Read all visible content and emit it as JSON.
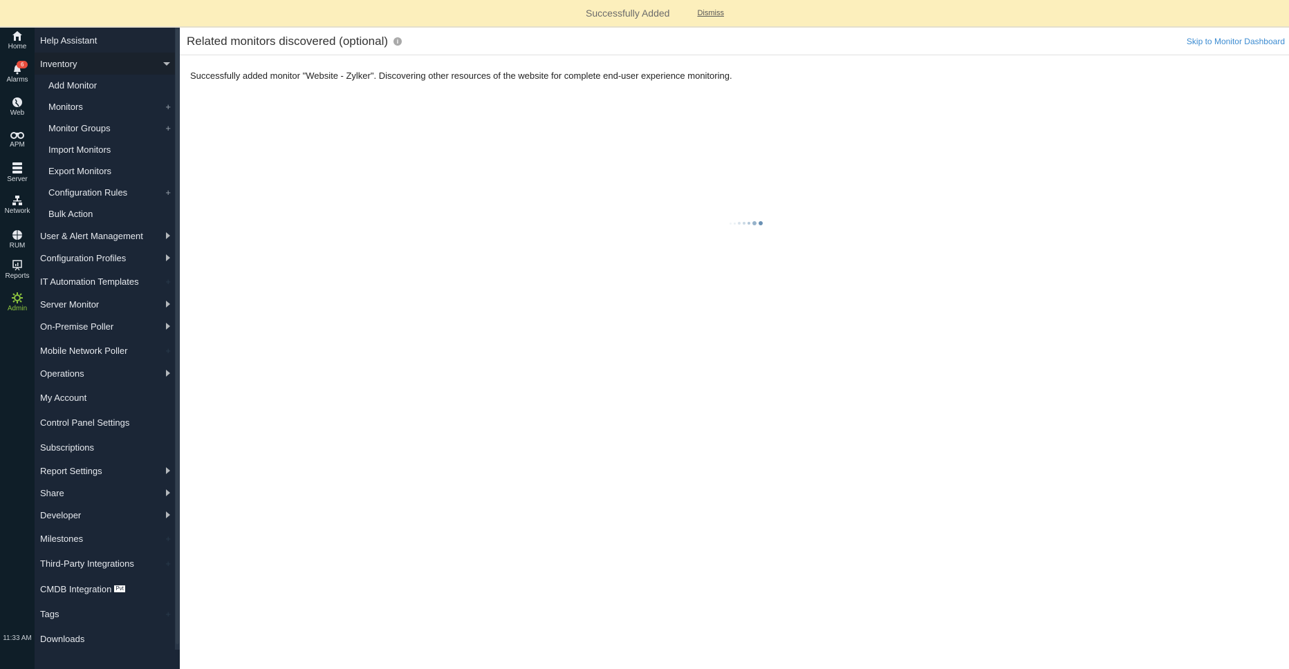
{
  "banner": {
    "message": "Successfully Added",
    "dismiss": "Dismiss"
  },
  "rail": {
    "items": [
      {
        "label": "Home",
        "icon": "home-icon"
      },
      {
        "label": "Alarms",
        "icon": "bell-icon",
        "badge": "6"
      },
      {
        "label": "Web",
        "icon": "globe-icon"
      },
      {
        "label": "APM",
        "icon": "binoculars-icon"
      },
      {
        "label": "Server",
        "icon": "server-icon"
      },
      {
        "label": "Network",
        "icon": "network-icon"
      },
      {
        "label": "RUM",
        "icon": "rum-globe-icon"
      },
      {
        "label": "Reports",
        "icon": "reports-icon"
      },
      {
        "label": "Admin",
        "icon": "gear-icon",
        "active": true
      }
    ],
    "time": "11:33 AM"
  },
  "menu": {
    "items": [
      {
        "label": "Help Assistant"
      },
      {
        "label": "Inventory",
        "indicator": "expanded"
      },
      {
        "label": "Add Monitor",
        "sub": true
      },
      {
        "label": "Monitors",
        "sub": true,
        "indicator": "plus"
      },
      {
        "label": "Monitor Groups",
        "sub": true,
        "indicator": "plus"
      },
      {
        "label": "Import Monitors",
        "sub": true
      },
      {
        "label": "Export Monitors",
        "sub": true
      },
      {
        "label": "Configuration Rules",
        "sub": true,
        "indicator": "plus"
      },
      {
        "label": "Bulk Action",
        "sub": true
      },
      {
        "label": "User & Alert Management",
        "indicator": "arrow"
      },
      {
        "label": "Configuration Profiles",
        "indicator": "arrow"
      },
      {
        "label": "IT Automation Templates",
        "indicator": "plus-faint"
      },
      {
        "label": "Server Monitor",
        "indicator": "arrow"
      },
      {
        "label": "On-Premise Poller",
        "indicator": "arrow"
      },
      {
        "label": "Mobile Network Poller",
        "indicator": "plus-faint"
      },
      {
        "label": "Operations",
        "indicator": "arrow"
      },
      {
        "label": "My Account"
      },
      {
        "label": "Control Panel Settings"
      },
      {
        "label": "Subscriptions"
      },
      {
        "label": "Report Settings",
        "indicator": "arrow"
      },
      {
        "label": "Share",
        "indicator": "arrow"
      },
      {
        "label": "Developer",
        "indicator": "arrow"
      },
      {
        "label": "Milestones",
        "indicator": "plus-faint"
      },
      {
        "label": "Third-Party Integrations",
        "indicator": "plus-faint"
      },
      {
        "label": "CMDB Integration",
        "tag": "Pvt"
      },
      {
        "label": "Tags",
        "indicator": "plus-faint"
      },
      {
        "label": "Downloads"
      }
    ]
  },
  "main": {
    "title": "Related monitors discovered (optional)",
    "info_icon": "i",
    "skip_link": "Skip to Monitor Dashboard",
    "description": "Successfully added monitor \"Website - Zylker\". Discovering other resources of the website for complete end-user experience monitoring."
  }
}
